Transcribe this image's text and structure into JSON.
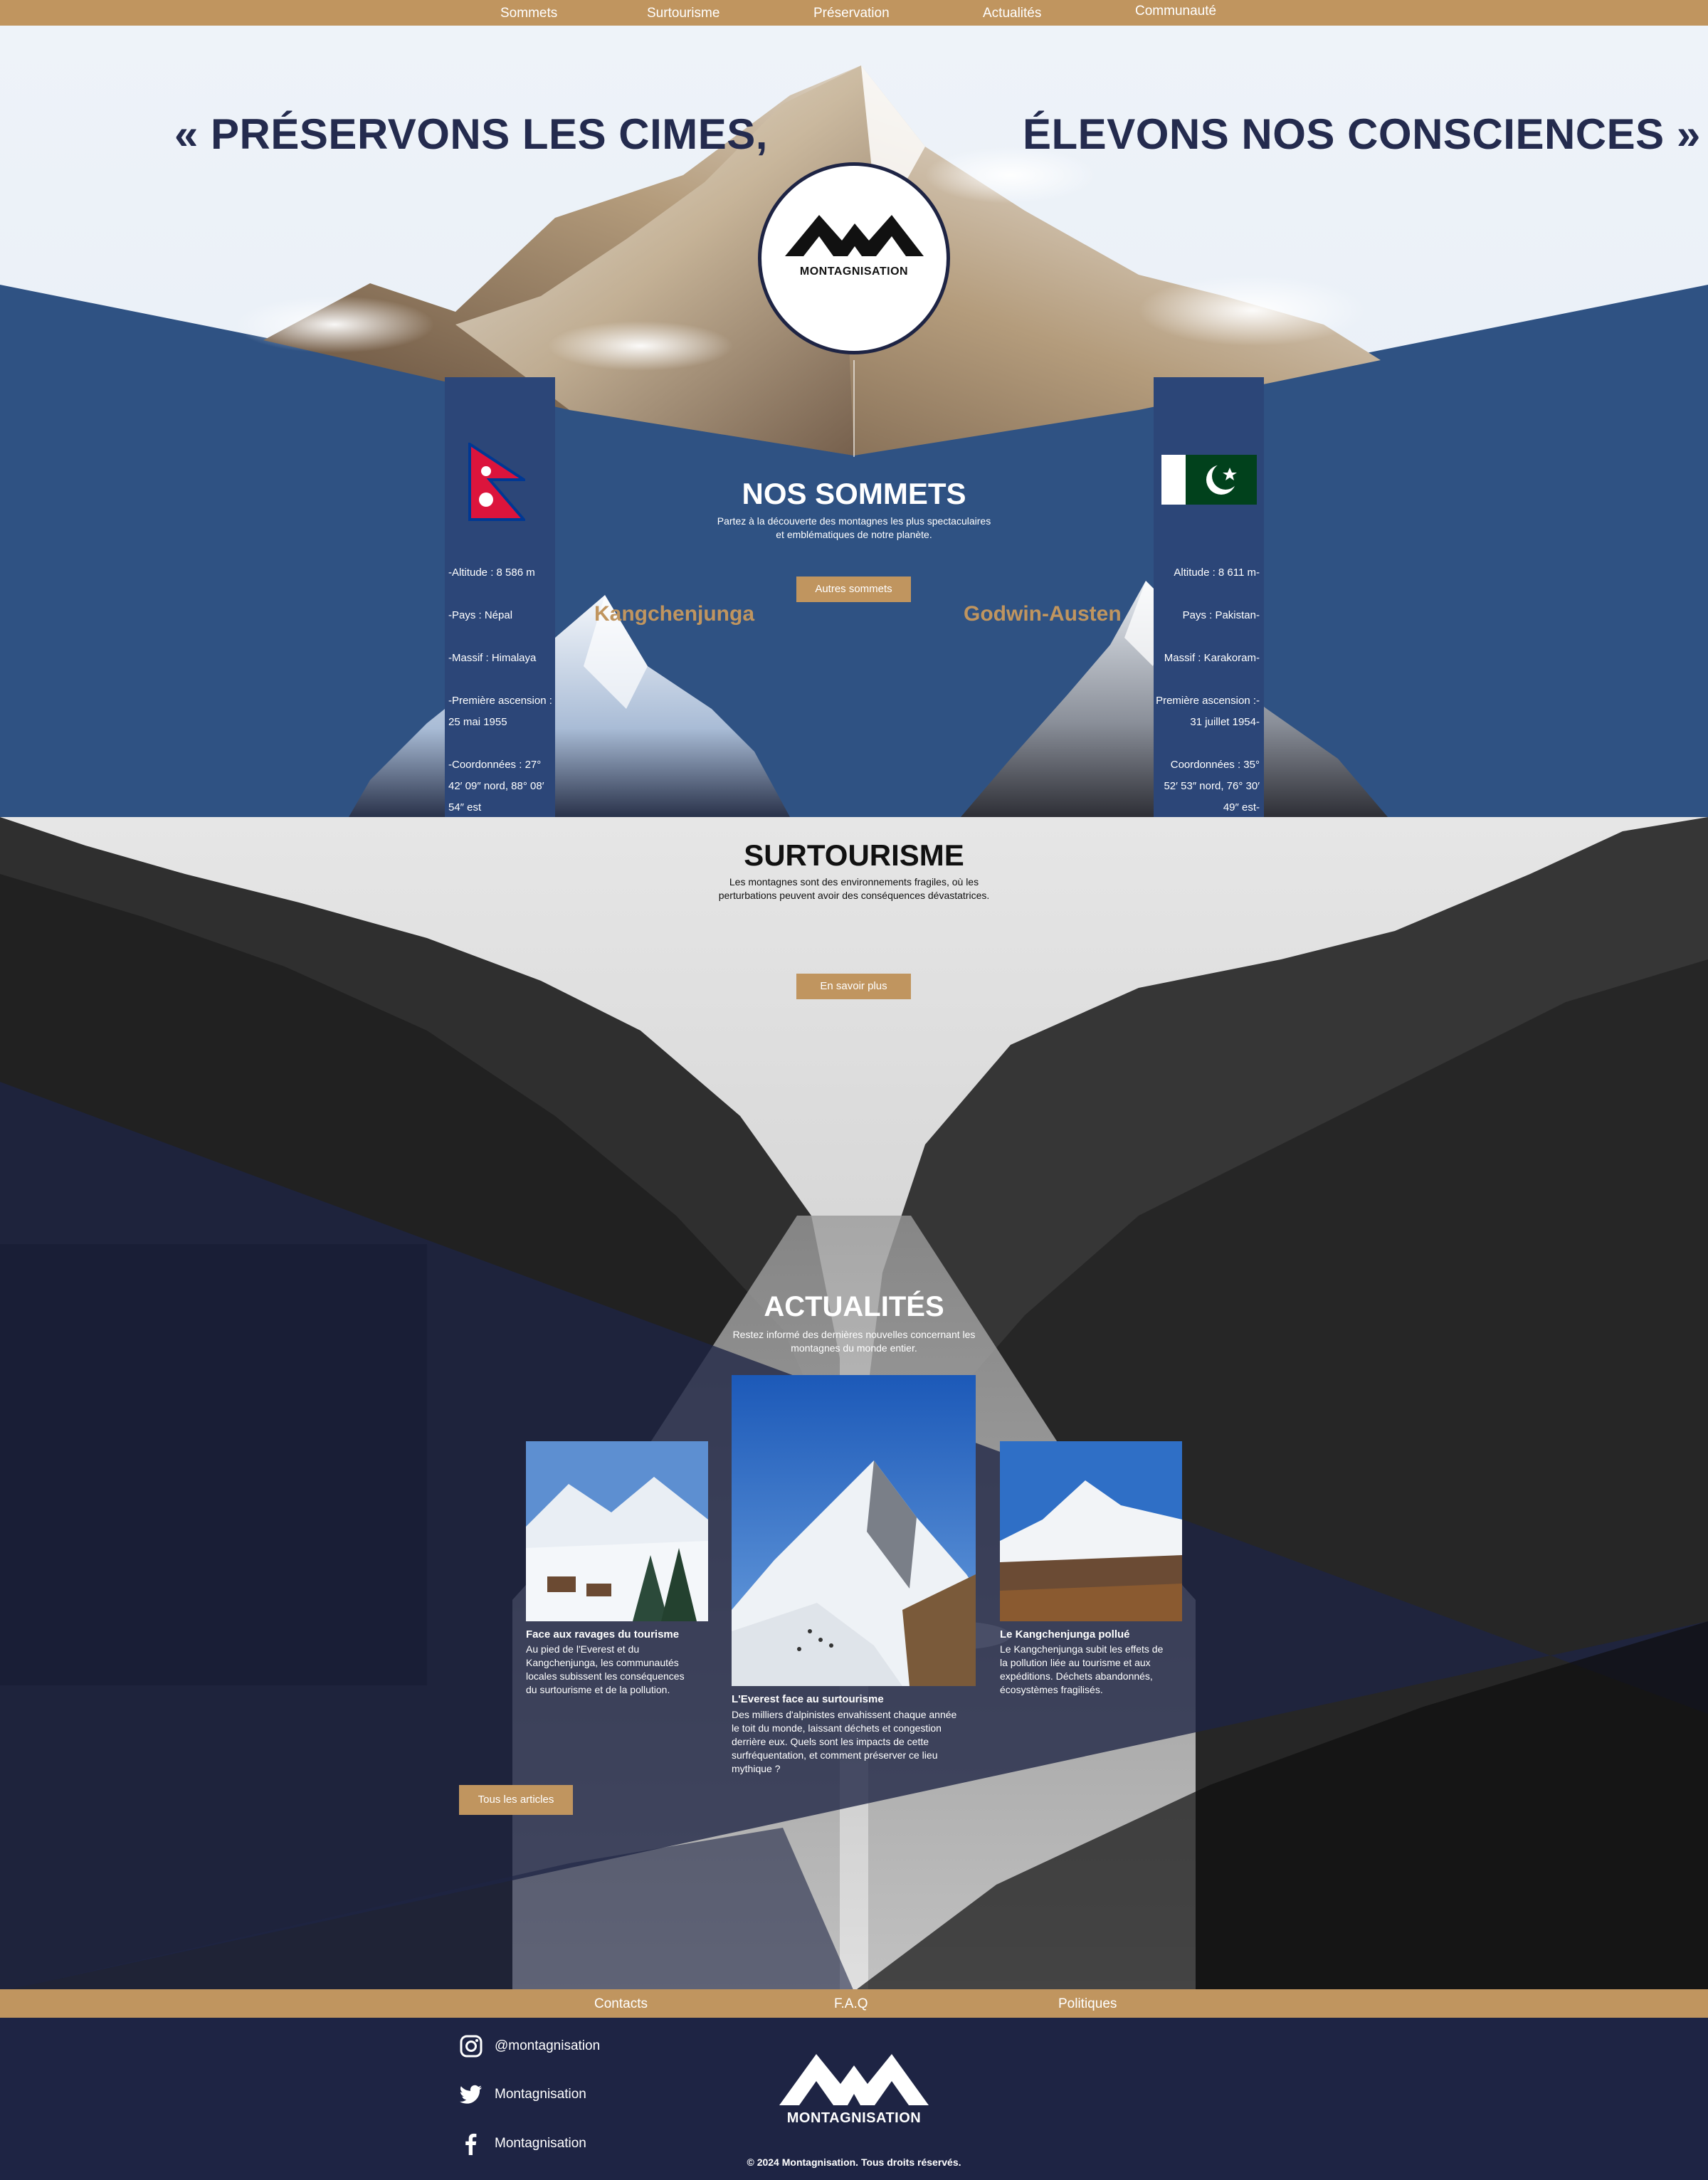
{
  "nav": {
    "items": [
      "Sommets",
      "Surtourisme",
      "Préservation",
      "Actualités",
      "Communauté"
    ]
  },
  "hero": {
    "quote_left": "« PRÉSERVONS LES CIMES,",
    "quote_right": "ÉLEVONS NOS CONSCIENCES »",
    "logo_text": "MONTAGNISATION"
  },
  "sommets": {
    "title": "NOS SOMMETS",
    "subtitle_line1": "Partez à la découverte des montagnes les plus spectaculaires",
    "subtitle_line2": "et emblématiques de notre planète.",
    "button": "Autres sommets",
    "left": {
      "name": "Kangchenjunga",
      "flag_icon": "nepal-flag-icon",
      "stats": [
        "-Altitude : 8 586 m",
        "-Pays : Népal",
        "-Massif : Himalaya",
        "-Première ascension :",
        "25 mai 1955",
        "-Coordonnées :  27°",
        "42′ 09″ nord, 88° 08′",
        "54″ est"
      ]
    },
    "right": {
      "name": "Godwin-Austen",
      "flag_icon": "pakistan-flag-icon",
      "stats": [
        "Altitude : 8 611 m-",
        "Pays : Pakistan-",
        "Massif : Karakoram-",
        "Première ascension :-",
        "31 juillet 1954-",
        "Coordonnées : 35°",
        "52′ 53″ nord, 76° 30′",
        "49″ est-"
      ]
    }
  },
  "surtourisme": {
    "title": "SURTOURISME",
    "subtitle_line1": "Les montagnes sont des environnements fragiles, où les",
    "subtitle_line2": "perturbations peuvent avoir des conséquences dévastatrices.",
    "button": "En savoir plus"
  },
  "actualites": {
    "title": "ACTUALITÉS",
    "subtitle_line1": "Restez informé des dernières nouvelles concernant les",
    "subtitle_line2": "montagnes du monde entier.",
    "button": "Tous les articles",
    "cards": [
      {
        "title": "Face aux ravages du tourisme",
        "lines": [
          "Au pied de l'Everest et du",
          "Kangchenjunga, les communautés",
          "locales subissent les conséquences",
          "du surtourisme et de la pollution."
        ]
      },
      {
        "title": "L'Everest face au surtourisme",
        "lines": [
          "Des milliers d'alpinistes envahissent chaque année",
          "le toit du monde, laissant déchets et congestion",
          "derrière eux. Quels sont les impacts de cette",
          "surfréquentation, et comment préserver ce lieu",
          "mythique ?"
        ]
      },
      {
        "title": "Le Kangchenjunga pollué",
        "lines": [
          "Le Kangchenjunga subit les effets de",
          "la pollution liée au tourisme et aux",
          "expéditions. Déchets abandonnés,",
          "écosystèmes fragilisés."
        ]
      }
    ]
  },
  "footer": {
    "nav": [
      "Contacts",
      "F.A.Q",
      "Politiques"
    ],
    "socials": [
      {
        "icon": "instagram-icon",
        "label": "@montagnisation"
      },
      {
        "icon": "twitter-icon",
        "label": "Montagnisation"
      },
      {
        "icon": "facebook-icon",
        "label": "Montagnisation"
      }
    ],
    "logo_text": "MONTAGNISATION",
    "copyright": "© 2024 Montagnisation. Tous droits réservés."
  },
  "colors": {
    "gold": "#c0955f",
    "navy": "#1e2444",
    "blue": "#2f5283"
  }
}
